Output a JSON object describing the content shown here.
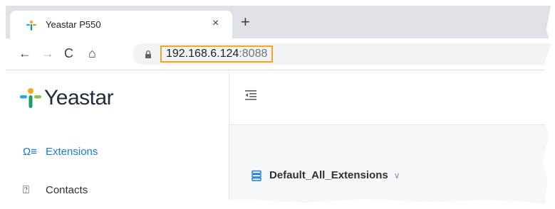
{
  "browser": {
    "tab_title": "Yeastar P550",
    "tab_close": "×",
    "new_tab": "+",
    "back": "←",
    "forward": "→",
    "reload": "C",
    "home": "⌂",
    "url_host": "192.168.6.124",
    "url_port": ":8088"
  },
  "app": {
    "logo_text": "Yeastar",
    "sidebar": {
      "items": [
        {
          "label": "Extensions",
          "icon": "extensions-icon",
          "active": true
        },
        {
          "label": "Contacts",
          "icon": "contacts-icon",
          "active": false
        }
      ]
    },
    "main": {
      "group_label": "Default_All_Extensions"
    }
  },
  "colors": {
    "highlight_border": "#f5a623",
    "active_nav": "#1a7bd6"
  }
}
